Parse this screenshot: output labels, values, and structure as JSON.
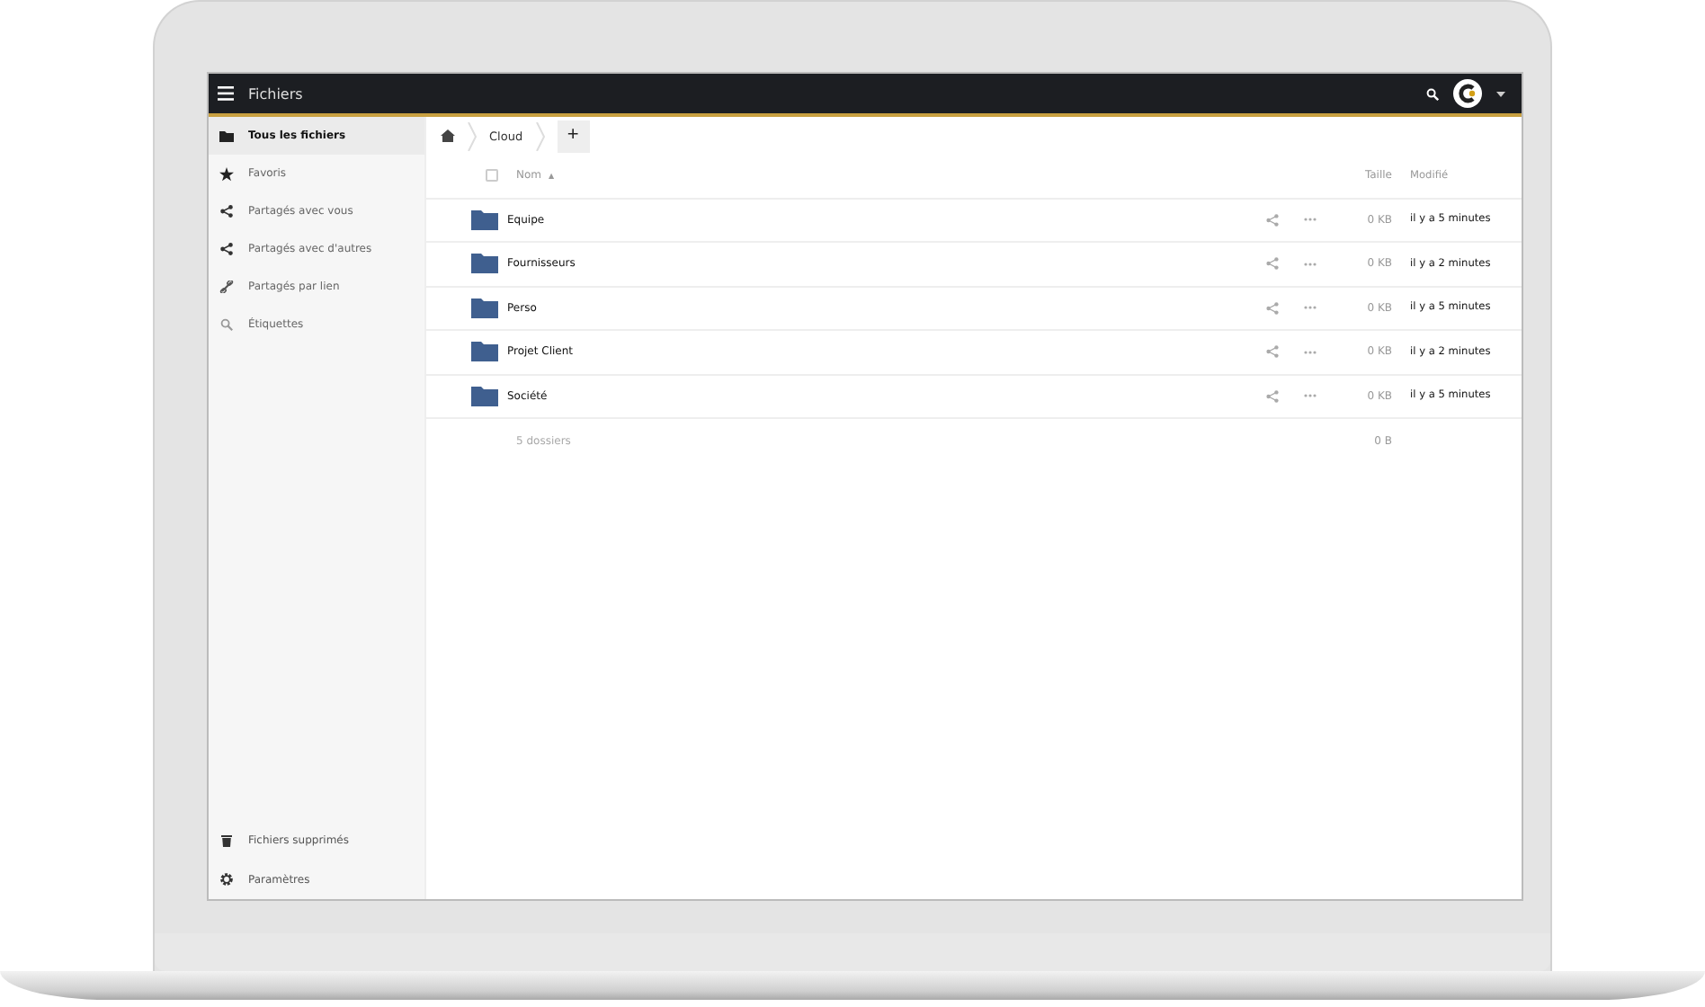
{
  "header": {
    "title": "Fichiers"
  },
  "sidebar": {
    "items": [
      {
        "label": "Tous les fichiers",
        "kind": "folder",
        "selected": true
      },
      {
        "label": "Favoris",
        "kind": "star",
        "selected": false
      },
      {
        "label": "Partagés avec vous",
        "kind": "share",
        "selected": false
      },
      {
        "label": "Partagés avec d'autres",
        "kind": "share",
        "selected": false
      },
      {
        "label": "Partagés par lien",
        "kind": "link",
        "selected": false
      },
      {
        "label": "Étiquettes",
        "kind": "tag",
        "selected": false
      }
    ],
    "footer_items": [
      {
        "label": "Fichiers supprimés",
        "kind": "trash"
      },
      {
        "label": "Paramètres",
        "kind": "gear"
      }
    ]
  },
  "breadcrumb": {
    "items": [
      "Cloud"
    ],
    "add_button": "+"
  },
  "table": {
    "select_all": {
      "checked": false
    },
    "columns": {
      "name": "Nom",
      "sort_indicator": "▲",
      "size": "Taille",
      "modified": "Modifié"
    },
    "rows": [
      {
        "name": "Equipe",
        "size": "0 KB",
        "modified": "il y a 5 minutes"
      },
      {
        "name": "Fournisseurs",
        "size": "0 KB",
        "modified": "il y a 2 minutes"
      },
      {
        "name": "Perso",
        "size": "0 KB",
        "modified": "il y a 5 minutes"
      },
      {
        "name": "Projet Client",
        "size": "0 KB",
        "modified": "il y a 2 minutes"
      },
      {
        "name": "Société",
        "size": "0 KB",
        "modified": "il y a 5 minutes"
      }
    ],
    "summary": {
      "count": "5 dossiers",
      "size": "0 B"
    }
  }
}
